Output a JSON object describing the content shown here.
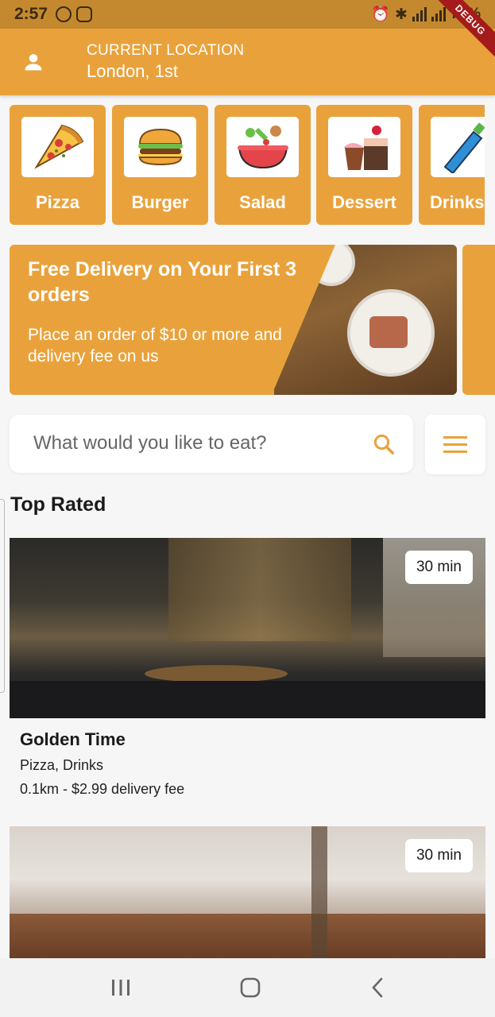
{
  "status_bar": {
    "time": "2:57",
    "battery": "77%"
  },
  "debug_banner": "DEBUG",
  "header": {
    "location_label": "CURRENT LOCATION",
    "location_value": "London, 1st"
  },
  "categories": [
    {
      "label": "Pizza",
      "icon": "pizza-icon"
    },
    {
      "label": "Burger",
      "icon": "burger-icon"
    },
    {
      "label": "Salad",
      "icon": "salad-icon"
    },
    {
      "label": "Dessert",
      "icon": "dessert-icon"
    },
    {
      "label": "Drinks",
      "icon": "drinks-icon"
    }
  ],
  "promo": {
    "title": "Free Delivery on Your First 3 orders",
    "subtitle": "Place an order of $10 or more and delivery fee on us"
  },
  "search": {
    "placeholder": "What would you like to eat?"
  },
  "section_title": "Top Rated",
  "restaurants": [
    {
      "name": "Golden Time",
      "tags": "Pizza, Drinks",
      "delivery": "0.1km - $2.99 delivery fee",
      "time": "30 min"
    },
    {
      "time": "30 min"
    }
  ],
  "colors": {
    "accent": "#e9a23b",
    "status_bar": "#c4892f",
    "background": "#f6f6f6"
  }
}
